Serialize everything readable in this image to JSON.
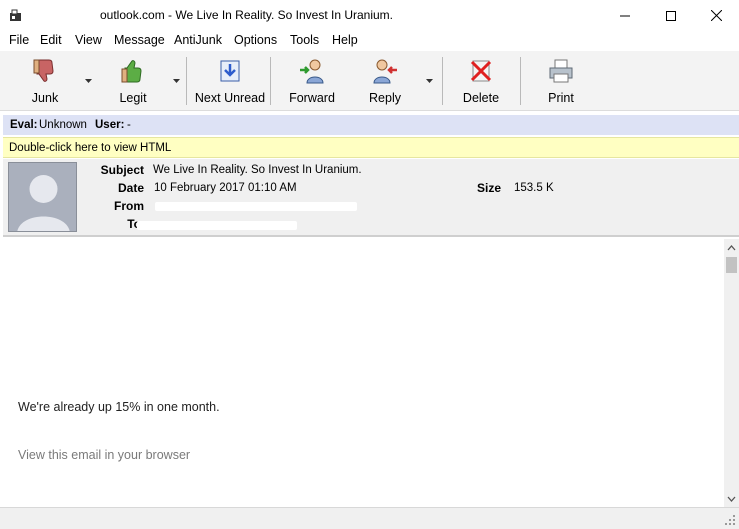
{
  "window": {
    "title": "outlook.com - We Live In Reality. So Invest In Uranium.",
    "app_icon": "mail-app-icon",
    "controls": [
      "minimize-icon",
      "maximize-icon",
      "close-icon"
    ]
  },
  "menu": {
    "items": [
      "File",
      "Edit",
      "View",
      "Message",
      "AntiJunk",
      "Options",
      "Tools",
      "Help"
    ]
  },
  "toolbar": {
    "junk": "Junk",
    "legit": "Legit",
    "next_unread": "Next Unread",
    "forward": "Forward",
    "reply": "Reply",
    "delete": "Delete",
    "print": "Print"
  },
  "eval_bar": {
    "eval_label": "Eval:",
    "eval_value": "Unknown",
    "user_label": "User:",
    "user_value": "-"
  },
  "html_bar": {
    "text": "Double-click here to view HTML"
  },
  "header": {
    "subject_label": "Subject",
    "subject_value": "We Live In Reality. So Invest In Uranium.",
    "date_label": "Date",
    "date_value": "10 February 2017 01:10 AM",
    "from_label": "From",
    "to_label": "To",
    "size_label": "Size",
    "size_value": "153.5 K"
  },
  "body": {
    "line1": "We're already up 15% in one month.",
    "line2": "View this email in your browser"
  },
  "colors": {
    "toolbar_bg": "#f3f3f3",
    "eval_bg": "#dde2f5",
    "html_bar_bg": "#ffffc2",
    "header_bg": "#f0f0f0",
    "delete_red": "#e02020"
  }
}
